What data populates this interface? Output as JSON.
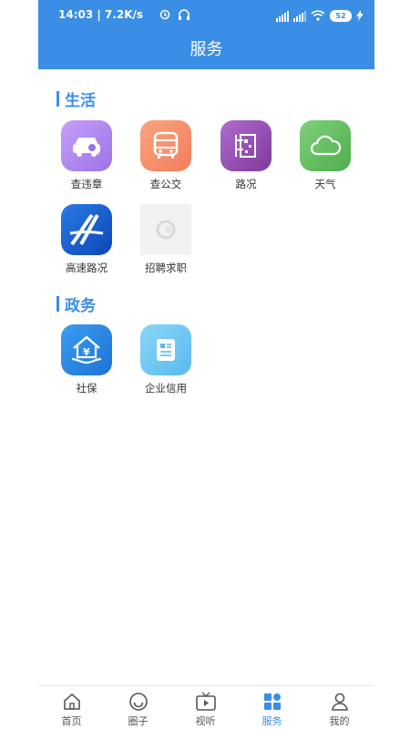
{
  "status": {
    "time": "14:03 | 7.2K/s",
    "battery": "52"
  },
  "header": {
    "title": "服务"
  },
  "sections": [
    {
      "title": "生活",
      "items": [
        {
          "label": "查违章",
          "icon": "car-search-icon",
          "color": "#b88cf0"
        },
        {
          "label": "查公交",
          "icon": "bus-icon",
          "color": "#f4956e"
        },
        {
          "label": "路况",
          "icon": "road-map-icon",
          "color": "#9d4fb4"
        },
        {
          "label": "天气",
          "icon": "cloud-icon",
          "color": "#6cc267"
        },
        {
          "label": "高速路况",
          "icon": "highway-icon",
          "color": "#1a64d6"
        },
        {
          "label": "招聘求职",
          "icon": "placeholder-image-icon",
          "color": "#f2f2f2"
        }
      ]
    },
    {
      "title": "政务",
      "items": [
        {
          "label": "社保",
          "icon": "social-security-house-icon",
          "color": "#2f8de4"
        },
        {
          "label": "企业信用",
          "icon": "document-icon",
          "color": "#73c8f5"
        }
      ]
    }
  ],
  "tabs": [
    {
      "label": "首页",
      "icon": "home-icon"
    },
    {
      "label": "圈子",
      "icon": "smiley-icon"
    },
    {
      "label": "视听",
      "icon": "tv-icon"
    },
    {
      "label": "服务",
      "icon": "grid-icon",
      "active": true
    },
    {
      "label": "我的",
      "icon": "person-icon"
    }
  ]
}
